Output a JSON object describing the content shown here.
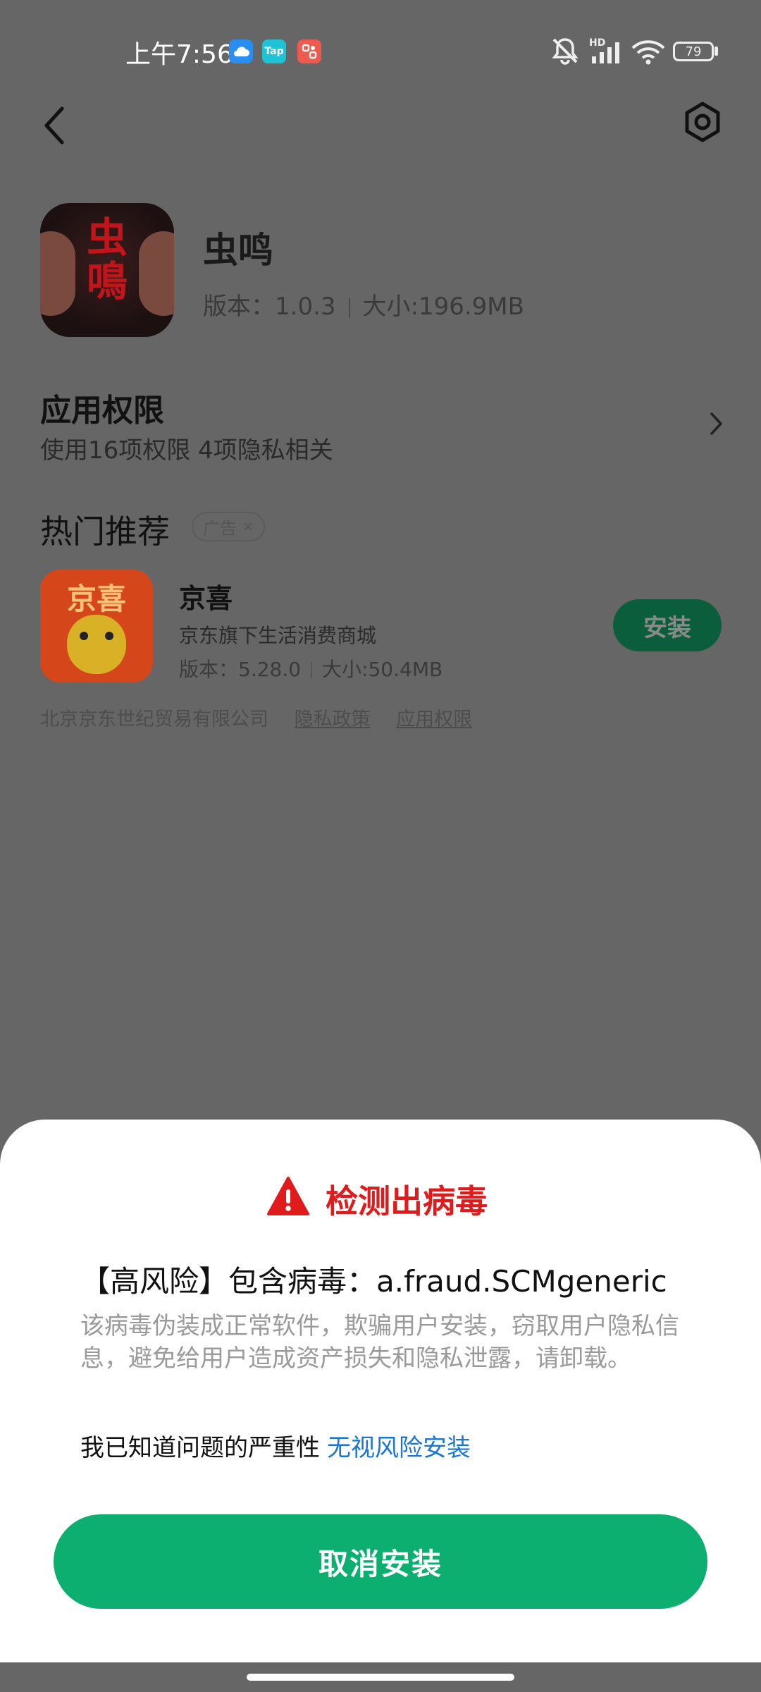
{
  "status_bar": {
    "time": "上午7:56",
    "battery": "79",
    "hd_label": "HD",
    "tap_label": "Tap"
  },
  "header": {
    "back_icon": "chevron-left-icon",
    "settings_icon": "gear-icon"
  },
  "app": {
    "name": "虫鸣",
    "version_label": "版本：1.0.3",
    "size_label": "大小:196.9MB",
    "icon_text": "虫鳴"
  },
  "permissions": {
    "title": "应用权限",
    "summary": "使用16项权限 4项隐私相关"
  },
  "recommend": {
    "title": "热门推荐",
    "ad_label": "广告",
    "item": {
      "name": "京喜",
      "description": "京东旗下生活消费商城",
      "version_label": "版本：5.28.0",
      "size_label": "大小:50.4MB",
      "install_label": "安装",
      "icon_text": "京喜"
    },
    "footer": {
      "company": "北京京东世纪贸易有限公司",
      "privacy": "隐私政策",
      "permissions": "应用权限"
    }
  },
  "dialog": {
    "title": "检测出病毒",
    "virus_line": "【高风险】包含病毒：a.fraud.SCMgeneric",
    "description": "该病毒伪装成正常软件，欺骗用户安装，窃取用户隐私信息，避免给用户造成资产损失和隐私泄露，请卸载。",
    "acknowledge": "我已知道问题的严重性",
    "ignore_link": "无视风险安装",
    "cancel_button": "取消安装"
  },
  "colors": {
    "danger": "#e01b1b",
    "primary_green": "#0caf6f",
    "link_blue": "#1a76d2"
  }
}
